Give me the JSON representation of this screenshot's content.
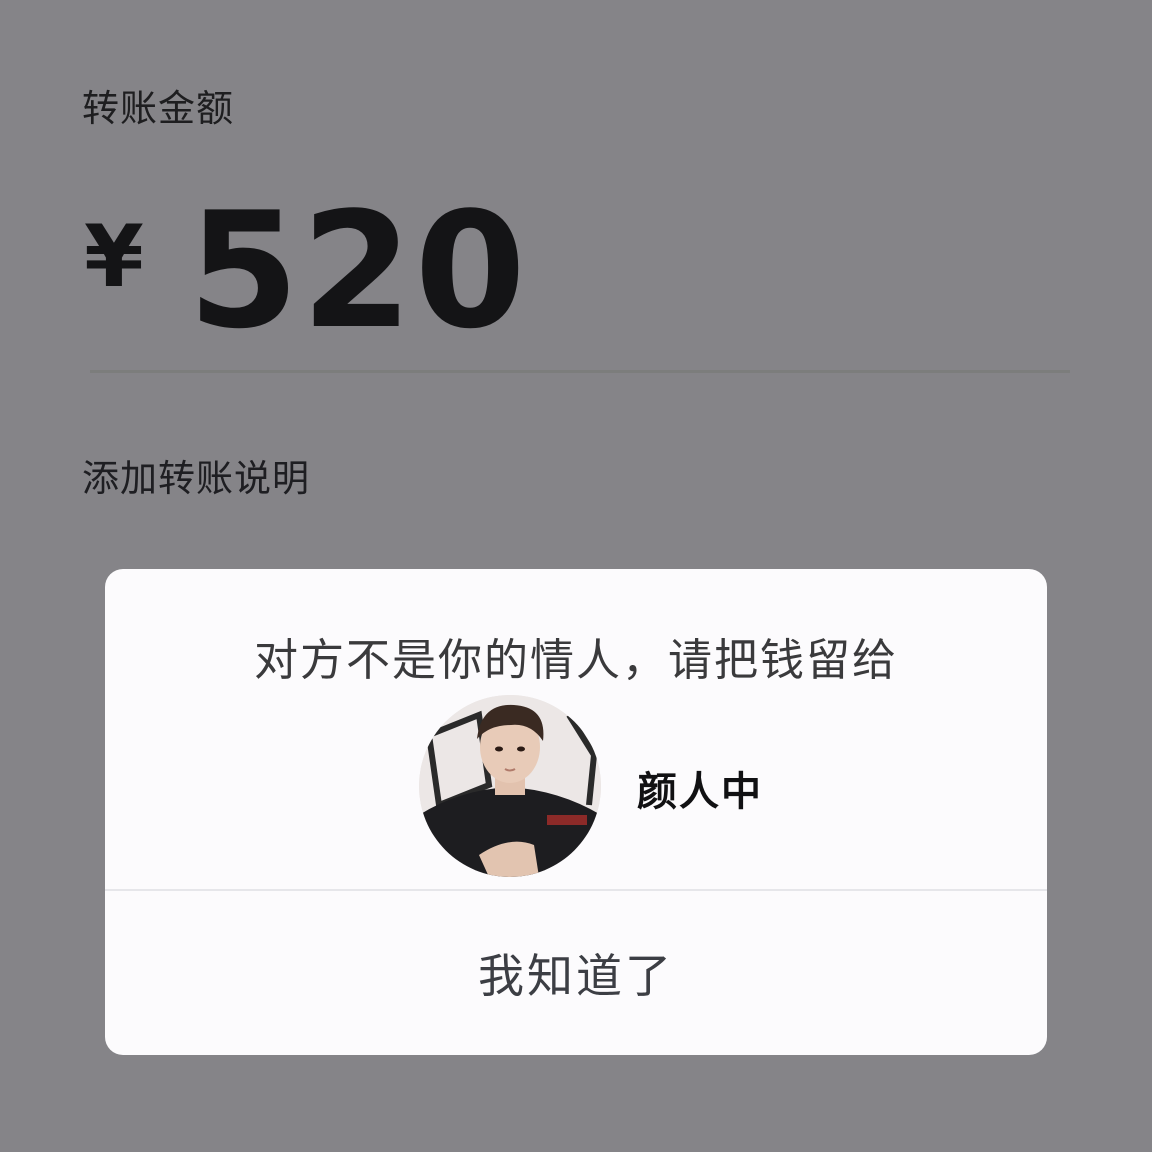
{
  "transfer": {
    "amount_label": "转账金额",
    "currency_symbol": "¥",
    "amount": "520",
    "add_note_label": "添加转账说明"
  },
  "dialog": {
    "message": "对方不是你的情人，请把钱留给",
    "recipient_name": "颜人中",
    "confirm_label": "我知道了",
    "avatar_icon": "person-photo-avatar"
  },
  "colors": {
    "background": "#858488",
    "dialog_background": "#fcfbfd",
    "text_dark": "#141416"
  }
}
